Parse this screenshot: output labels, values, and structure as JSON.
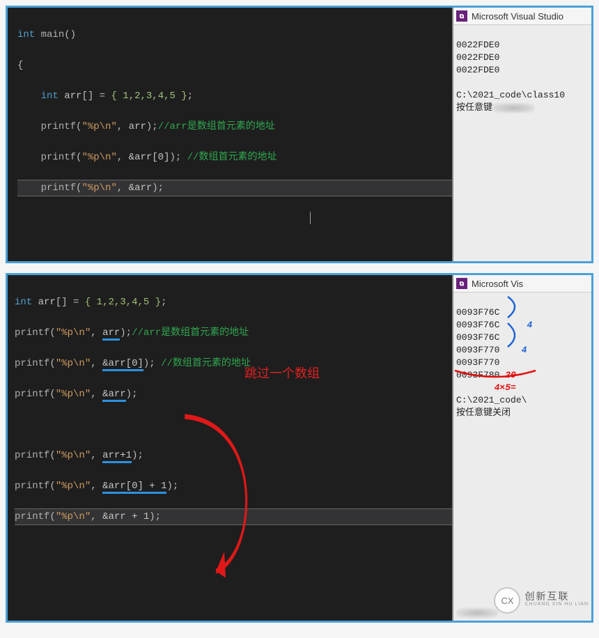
{
  "panel1": {
    "editor": {
      "decl_kw": "int",
      "main_id": "main",
      "open_paren": "()",
      "brace": "{",
      "int_kw": "int",
      "arr_id": "arr",
      "brackets": "[]",
      "eq": " = ",
      "arr_vals": "{ 1,2,3,4,5 }",
      "semi": ";",
      "printf": "printf",
      "fmt_dq": "\"%p\\n\"",
      "comma": ", ",
      "arg_arr": "arr",
      "arg_arr0": "&arr[0]",
      "arg_amp_arr": "&arr",
      "cmt1_text": "是数组首元素的地址",
      "cmt1_prefix": "//arr",
      "cmt2_prefix": " //",
      "cmt2_text": "数组首元素的地址",
      "close_paren_semi": ");"
    },
    "console": {
      "title": "Microsoft Visual Studio",
      "lines": [
        "0022FDE0",
        "0022FDE0",
        "0022FDE0",
        "",
        "C:\\2021_code\\class10"
      ],
      "press_any": "按任意键"
    }
  },
  "panel2": {
    "editor": {
      "int_kw": "int",
      "arr_id": "arr",
      "brackets": "[]",
      "eq": " = ",
      "arr_vals": "{ 1,2,3,4,5 }",
      "semi": ";",
      "printf": "printf",
      "fmt_dq": "\"%p\\n\"",
      "comma": ", ",
      "arg_arr": "arr",
      "arg_arr0": "&arr[0]",
      "arg_amp_arr": "&arr",
      "arg_arr_p1": "arr+1",
      "arg_arr0_p1": "&arr[0] + 1",
      "arg_amp_arr_p1": "&arr + 1",
      "cmt1_prefix": "//arr",
      "cmt1_text": "是数组首元素的地址",
      "cmt2_prefix": " //",
      "cmt2_text": "数组首元素的地址",
      "close_paren_semi": ");",
      "annotation_red": "跳过一个数组"
    },
    "console": {
      "title": "Microsoft Vis",
      "lines": [
        "0093F76C",
        "0093F76C",
        "0093F76C",
        "0093F770",
        "0093F770",
        "0093F780",
        "",
        "C:\\2021_code\\"
      ],
      "press_any": "按任意键关闭",
      "hand_blue_1": "4",
      "hand_blue_2": "4",
      "hand_red_1": "20",
      "hand_red_2": "4×5="
    }
  },
  "watermark": {
    "logo": "CX",
    "cn": "创新互联",
    "en": "CHUANG XIN HU LIAN"
  }
}
